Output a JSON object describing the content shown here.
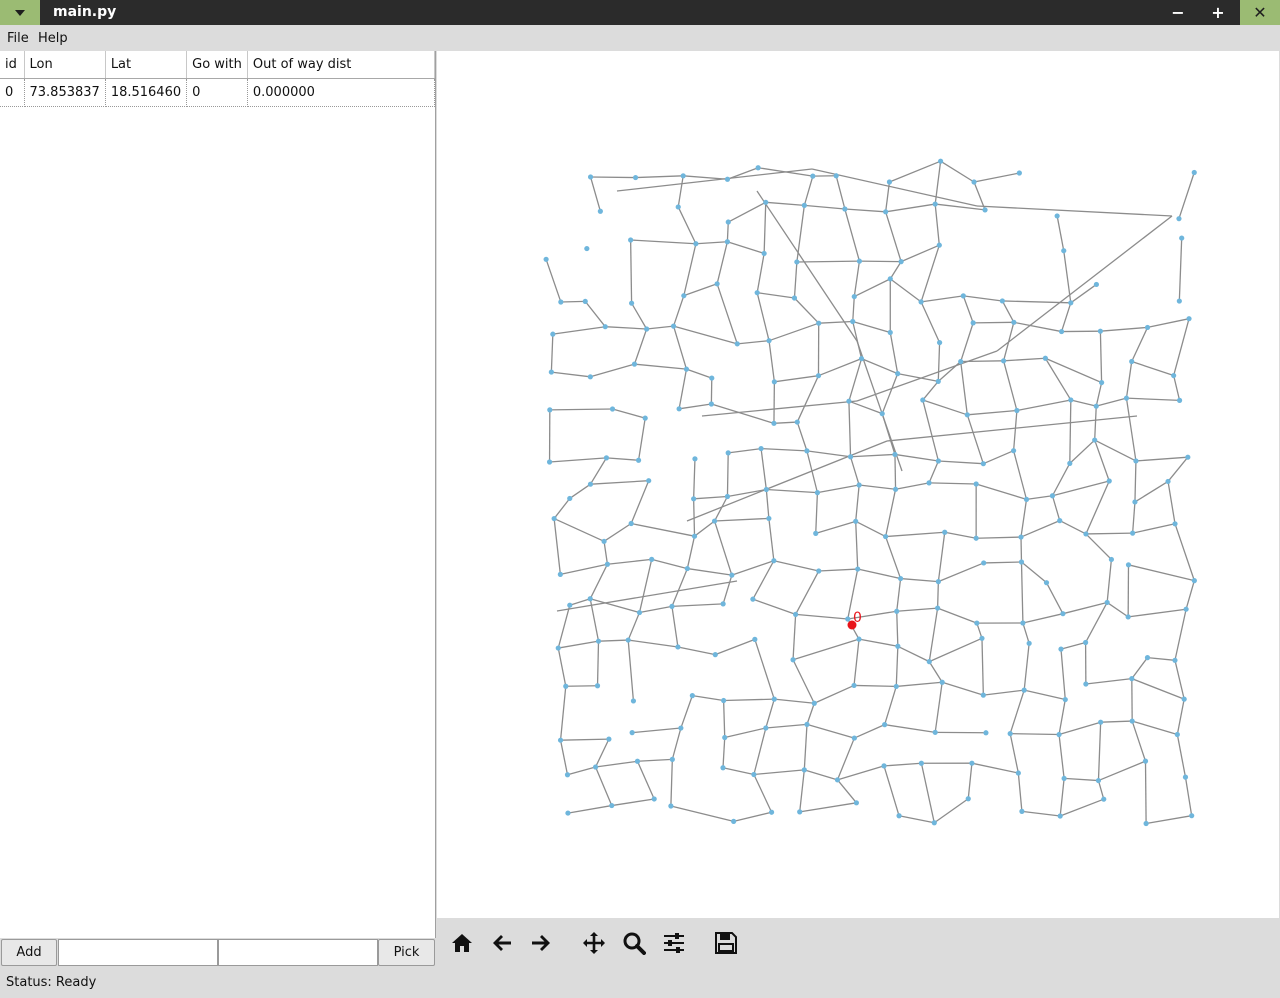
{
  "window": {
    "title": "main.py",
    "minimize_label": "−",
    "maximize_label": "+",
    "close_label": "✕"
  },
  "menu": {
    "file": "File",
    "help": "Help"
  },
  "table": {
    "columns": [
      "id",
      "Lon",
      "Lat",
      "Go with",
      "Out of way dist"
    ],
    "rows": [
      [
        "0",
        "73.853837",
        "18.516460",
        "0",
        "0.000000"
      ]
    ]
  },
  "controls": {
    "add_label": "Add",
    "field1_value": "",
    "field2_value": "",
    "pick_label": "Pick"
  },
  "status": {
    "text": "Status: Ready"
  },
  "map": {
    "marker_label": "0",
    "node_color": "#6fb6dc",
    "edge_color": "#8c8c8c",
    "marker_color": "#e8141a"
  },
  "toolbar": {
    "icons": [
      "home-icon",
      "back-arrow-icon",
      "forward-arrow-icon",
      "pan-icon",
      "zoom-icon",
      "configure-subplots-icon",
      "save-icon"
    ]
  },
  "colors": {
    "titlebar_bg": "#2b2b2b",
    "titlebar_accent": "#9bbb73",
    "panel_bg": "#dcdcdc"
  }
}
